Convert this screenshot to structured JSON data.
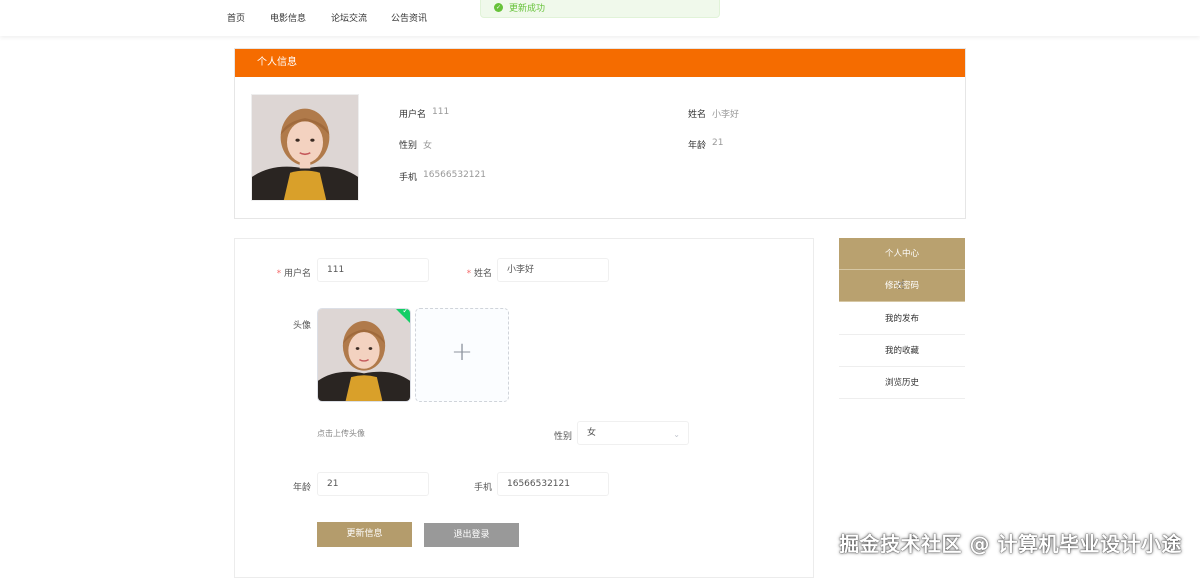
{
  "nav": {
    "items": [
      "首页",
      "电影信息",
      "论坛交流",
      "公告资讯"
    ]
  },
  "toast": {
    "message": "更新成功"
  },
  "info_card": {
    "title": "个人信息",
    "username_label": "用户名",
    "username_value": "111",
    "name_label": "姓名",
    "name_value": "小李好",
    "gender_label": "性别",
    "gender_value": "女",
    "age_label": "年龄",
    "age_value": "21",
    "phone_label": "手机",
    "phone_value": "16566532121"
  },
  "form": {
    "username_label": "用户名",
    "username_value": "111",
    "name_label": "姓名",
    "name_value": "小李好",
    "avatar_label": "头像",
    "upload_hint": "点击上传头像",
    "gender_label": "性别",
    "gender_value": "女",
    "age_label": "年龄",
    "age_value": "21",
    "phone_label": "手机",
    "phone_value": "16566532121",
    "required_mark": "*",
    "update_button": "更新信息",
    "logout_button": "退出登录"
  },
  "side_menu": {
    "items": [
      "个人中心",
      "修改密码",
      "我的发布",
      "我的收藏",
      "浏览历史"
    ]
  },
  "watermark": "掘金技术社区 @ 计算机毕业设计小途",
  "colors": {
    "header_orange": "#f56c00",
    "accent_gold": "#b9a16f",
    "success_green": "#67c23a"
  }
}
